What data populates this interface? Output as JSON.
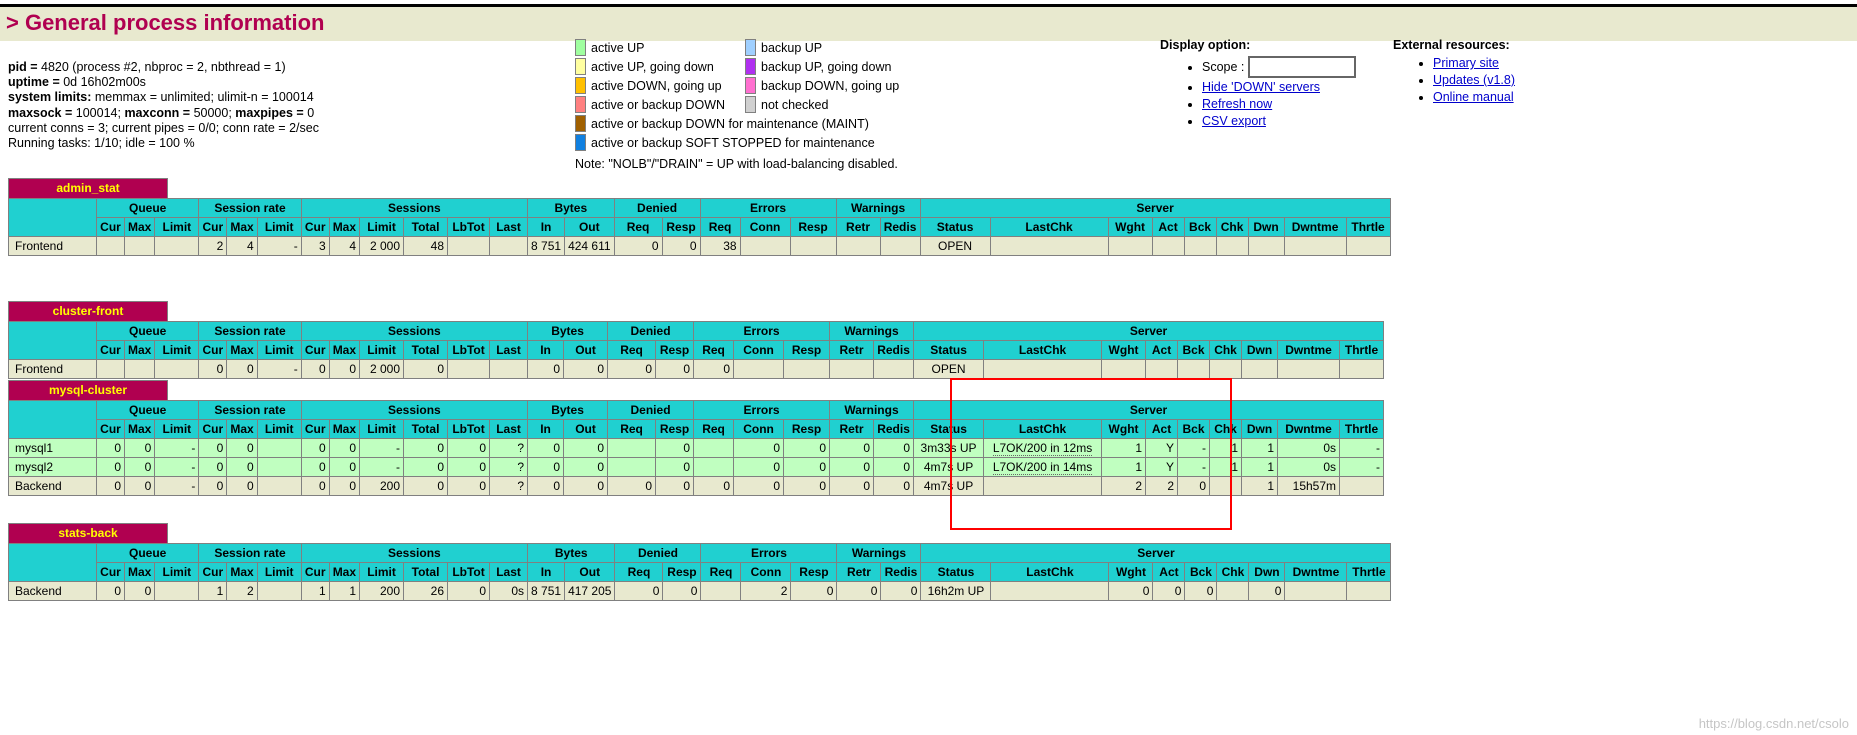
{
  "header": {
    "title": "> General process information"
  },
  "process_info": {
    "lines": [
      [
        {
          "b": "pid = "
        },
        {
          "t": "4820 (process #2, nbproc = 2, nbthread = 1)"
        }
      ],
      [
        {
          "b": "uptime = "
        },
        {
          "t": "0d 16h02m00s"
        }
      ],
      [
        {
          "b": "system limits:"
        },
        {
          "t": " memmax = unlimited; ulimit-n = 100014"
        }
      ],
      [
        {
          "b": "maxsock = "
        },
        {
          "t": "100014; "
        },
        {
          "b": "maxconn = "
        },
        {
          "t": "50000; "
        },
        {
          "b": "maxpipes = "
        },
        {
          "t": "0"
        }
      ],
      [
        {
          "t": "current conns = 3; current pipes = 0/0; conn rate = 2/sec"
        }
      ],
      [
        {
          "t": "Running tasks: 1/10; idle = 100 %"
        }
      ]
    ]
  },
  "legend": {
    "left_column": [
      {
        "color": "#a0ffa0",
        "label": "active UP"
      },
      {
        "color": "#ffffa0",
        "label": "active UP, going down"
      },
      {
        "color": "#ffc000",
        "label": "active DOWN, going up"
      },
      {
        "color": "#ff8080",
        "label": "active or backup DOWN"
      },
      {
        "color": "#a06000",
        "label": "active or backup DOWN for maintenance (MAINT)"
      },
      {
        "color": "#1080e0",
        "label": "active or backup SOFT STOPPED for maintenance"
      }
    ],
    "right_column": [
      {
        "color": "#a0d0ff",
        "label": "backup UP"
      },
      {
        "color": "#b030f0",
        "label": "backup UP, going down"
      },
      {
        "color": "#ff70d0",
        "label": "backup DOWN, going up"
      },
      {
        "color": "#d0d0d0",
        "label": "not checked"
      }
    ],
    "note": "Note: \"NOLB\"/\"DRAIN\" = UP with load-balancing disabled."
  },
  "display_option": {
    "heading": "Display option:",
    "scope_label": "Scope :",
    "scope_value": "",
    "scope_placeholder": "",
    "links": [
      "Hide 'DOWN' servers",
      "Refresh now",
      "CSV export"
    ]
  },
  "external_resources": {
    "heading": "External resources:",
    "links": [
      "Primary site",
      "Updates (v1.8)",
      "Online manual"
    ]
  },
  "table_headers": {
    "groups": [
      "Queue",
      "Session rate",
      "Sessions",
      "Bytes",
      "Denied",
      "Errors",
      "Warnings",
      "Server"
    ],
    "queue": [
      "Cur",
      "Max",
      "Limit"
    ],
    "session_rate": [
      "Cur",
      "Max",
      "Limit"
    ],
    "sessions": [
      "Cur",
      "Max",
      "Limit",
      "Total",
      "LbTot",
      "Last"
    ],
    "bytes": [
      "In",
      "Out"
    ],
    "denied": [
      "Req",
      "Resp"
    ],
    "errors": [
      "Req",
      "Conn",
      "Resp"
    ],
    "warnings": [
      "Retr",
      "Redis"
    ],
    "server": [
      "Status",
      "LastChk",
      "Wght",
      "Act",
      "Bck",
      "Chk",
      "Dwn",
      "Dwntme",
      "Thrtle"
    ]
  },
  "proxies": [
    {
      "name": "admin_stat",
      "rows": [
        {
          "type": "frontend",
          "state": "backend",
          "name": "Frontend",
          "cells": [
            "",
            "",
            "",
            "2",
            "4",
            "-",
            "3",
            "4",
            "2 000",
            "48",
            "",
            "",
            "8 751",
            "424 611",
            "0",
            "0",
            "38",
            "",
            "",
            "",
            "",
            "OPEN",
            "",
            "",
            "",
            "",
            "",
            "",
            "",
            ""
          ]
        }
      ]
    },
    {
      "name": "cluster-front",
      "rows": [
        {
          "type": "frontend",
          "state": "backend",
          "name": "Frontend",
          "cells": [
            "",
            "",
            "",
            "0",
            "0",
            "-",
            "0",
            "0",
            "2 000",
            "0",
            "",
            "",
            "0",
            "0",
            "0",
            "0",
            "0",
            "",
            "",
            "",
            "",
            "OPEN",
            "",
            "",
            "",
            "",
            "",
            "",
            "",
            ""
          ]
        }
      ]
    },
    {
      "name": "mysql-cluster",
      "rows": [
        {
          "type": "server",
          "state": "up",
          "name": "mysql1",
          "cells": [
            "0",
            "0",
            "-",
            "0",
            "0",
            "",
            "0",
            "0",
            "-",
            "0",
            "0",
            "?",
            "0",
            "0",
            "",
            "0",
            "",
            "0",
            "0",
            "0",
            "0",
            "3m33s UP",
            "L7OK/200 in 12ms",
            "1",
            "Y",
            "-",
            "1",
            "1",
            "0s",
            "-"
          ]
        },
        {
          "type": "server",
          "state": "up",
          "name": "mysql2",
          "cells": [
            "0",
            "0",
            "-",
            "0",
            "0",
            "",
            "0",
            "0",
            "-",
            "0",
            "0",
            "?",
            "0",
            "0",
            "",
            "0",
            "",
            "0",
            "0",
            "0",
            "0",
            "4m7s UP",
            "L7OK/200 in 14ms",
            "1",
            "Y",
            "-",
            "1",
            "1",
            "0s",
            "-"
          ]
        },
        {
          "type": "backend",
          "state": "backend",
          "name": "Backend",
          "cells": [
            "0",
            "0",
            "-",
            "0",
            "0",
            "",
            "0",
            "0",
            "200",
            "0",
            "0",
            "?",
            "0",
            "0",
            "0",
            "0",
            "0",
            "0",
            "0",
            "0",
            "0",
            "4m7s UP",
            "",
            "2",
            "2",
            "0",
            "",
            "1",
            "15h57m",
            ""
          ]
        }
      ]
    },
    {
      "name": "stats-back",
      "rows": [
        {
          "type": "backend",
          "state": "backend",
          "name": "Backend",
          "cells": [
            "0",
            "0",
            "",
            "1",
            "2",
            "",
            "1",
            "1",
            "200",
            "26",
            "0",
            "0s",
            "8 751",
            "417 205",
            "0",
            "0",
            "",
            "2",
            "0",
            "0",
            "0",
            "16h2m UP",
            "",
            "0",
            "0",
            "0",
            "",
            "0",
            "",
            ""
          ]
        }
      ]
    }
  ],
  "annotation": {
    "box_color": "#ff0000"
  },
  "watermark": "https://blog.csdn.net/csolo"
}
